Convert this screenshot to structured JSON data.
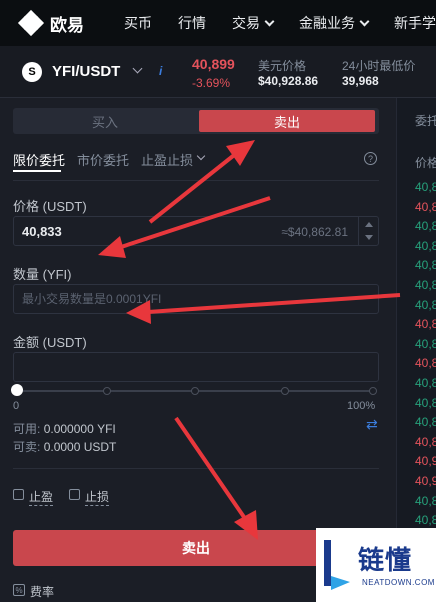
{
  "nav": {
    "brand": "欧易",
    "items": [
      {
        "label": "买币",
        "has_dropdown": false
      },
      {
        "label": "行情",
        "has_dropdown": false
      },
      {
        "label": "交易",
        "has_dropdown": true
      },
      {
        "label": "金融业务",
        "has_dropdown": true
      },
      {
        "label": "新手学",
        "has_dropdown": false
      }
    ]
  },
  "ticker": {
    "coin_icon": "yfi-coin-icon",
    "coin_glyph": "S",
    "pair": "YFI/USDT",
    "info_glyph": "i",
    "last_price": "40,899",
    "change": "-3.69%",
    "usd_price_label": "美元价格",
    "usd_price": "$40,928.86",
    "low_24h_label": "24小时最低价",
    "low_24h": "39,968",
    "colors": {
      "down": "#e4535c"
    }
  },
  "order_panel": {
    "side_tabs": {
      "buy": "买入",
      "sell": "卖出",
      "active": "sell"
    },
    "order_types": {
      "limit": "限价委托",
      "market": "市价委托",
      "stop": "止盈止损",
      "active": "limit"
    },
    "help_glyph": "?",
    "price": {
      "label": "价格 (USDT)",
      "value": "40,833",
      "approx": "≈$40,862.81"
    },
    "quantity": {
      "label": "数量 (YFI)",
      "placeholder": "最小交易数量是0.0001YFI",
      "value": ""
    },
    "amount": {
      "label": "金额 (USDT)",
      "value": ""
    },
    "slider": {
      "min_label": "0",
      "max_label": "100%",
      "level": 0
    },
    "available": {
      "label": "可用:",
      "value": "0.000000 YFI"
    },
    "sellable": {
      "label": "可卖:",
      "value": "0.0000 USDT"
    },
    "swap_glyph": "⇄",
    "take_profit": "止盈",
    "stop_loss": "止损",
    "submit": "卖出",
    "fee_glyph": "%",
    "fee": "费率",
    "colors": {
      "sell": "#c9474d"
    }
  },
  "orderbook": {
    "tab": "委托",
    "header": "价格",
    "rows": [
      {
        "price": "40,8",
        "side": "buy"
      },
      {
        "price": "40,8",
        "side": "sell"
      },
      {
        "price": "40,8",
        "side": "buy"
      },
      {
        "price": "40,8",
        "side": "buy"
      },
      {
        "price": "40,8",
        "side": "buy"
      },
      {
        "price": "40,8",
        "side": "buy"
      },
      {
        "price": "40,8",
        "side": "buy"
      },
      {
        "price": "40,8",
        "side": "sell"
      },
      {
        "price": "40,8",
        "side": "buy"
      },
      {
        "price": "40,8",
        "side": "sell"
      },
      {
        "price": "40,8",
        "side": "buy"
      },
      {
        "price": "40,8",
        "side": "buy"
      },
      {
        "price": "40,8",
        "side": "buy"
      },
      {
        "price": "40,8",
        "side": "sell"
      },
      {
        "price": "40,9",
        "side": "sell"
      },
      {
        "price": "40,9",
        "side": "sell"
      },
      {
        "price": "40,8",
        "side": "buy"
      },
      {
        "price": "40,8",
        "side": "buy"
      }
    ]
  },
  "watermark": {
    "text": "链懂",
    "sub": "NEATDOWN.COM"
  }
}
